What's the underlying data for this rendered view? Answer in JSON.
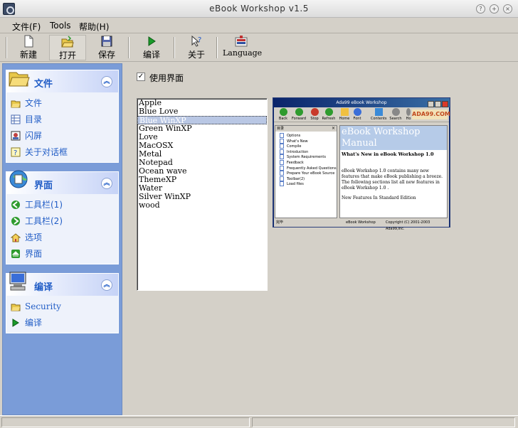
{
  "window": {
    "title": "eBook Workshop v1.5"
  },
  "menu": [
    "文件(F)",
    "Tools",
    "帮助(H)"
  ],
  "toolbar": {
    "new": "新建",
    "open": "打开",
    "save": "保存",
    "compile": "编译",
    "about": "关于",
    "language": "Language"
  },
  "sidebar": {
    "groups": [
      {
        "title": "文件",
        "items": [
          "文件",
          "目录",
          "闪屏",
          "关于对话框"
        ]
      },
      {
        "title": "界面",
        "items": [
          "工具栏(1)",
          "工具栏(2)",
          "选项",
          "界面"
        ]
      },
      {
        "title": "编译",
        "items": [
          "Security",
          "编译"
        ]
      }
    ]
  },
  "main": {
    "use_interface_label": "使用界面",
    "use_interface_checked": true,
    "skins": [
      "Apple",
      "Blue Love",
      "Blue WinXP",
      "Green WinXP",
      "Love",
      "MacOSX",
      "Metal",
      "Notepad",
      "Ocean wave",
      "ThemeXP",
      "Water",
      "Silver WinXP",
      "wood"
    ],
    "selected_skin": "Blue WinXP"
  },
  "preview": {
    "title": "Ada99 eBook Workshop",
    "toolbar": [
      "Back",
      "Forward",
      "Stop",
      "Refresh",
      "Home",
      "Font",
      "Contents",
      "Search",
      "Ho"
    ],
    "logo": "ADA99.COM",
    "toc_title": "目录",
    "toc": [
      "Options",
      "What's New",
      "Compile",
      "Introduction",
      "System Requirements",
      "Feedback",
      "Frequently Asked Questions",
      "Prepare Your eBook Source",
      "Toolbar(2)",
      "Load files"
    ],
    "heading": "eBook Workshop Manual",
    "subheading": "What's New in eBook Workshop 1.0",
    "para1": "eBook Workshop 1.0 contains many new features that make eBook publishing a breeze. The following sections list all new features in eBook Workshop 1.0 .",
    "para2": "New Features In Standard Edition",
    "status_left": "完毕",
    "status_mid": "eBook Workshop",
    "status_right": "Copyright (C) 2001-2003 Ada99,Inc."
  },
  "colors": {
    "sidebar_bg": "#7a9cd8",
    "group_title": "#215dc6",
    "selection": "#b9c7e4"
  }
}
